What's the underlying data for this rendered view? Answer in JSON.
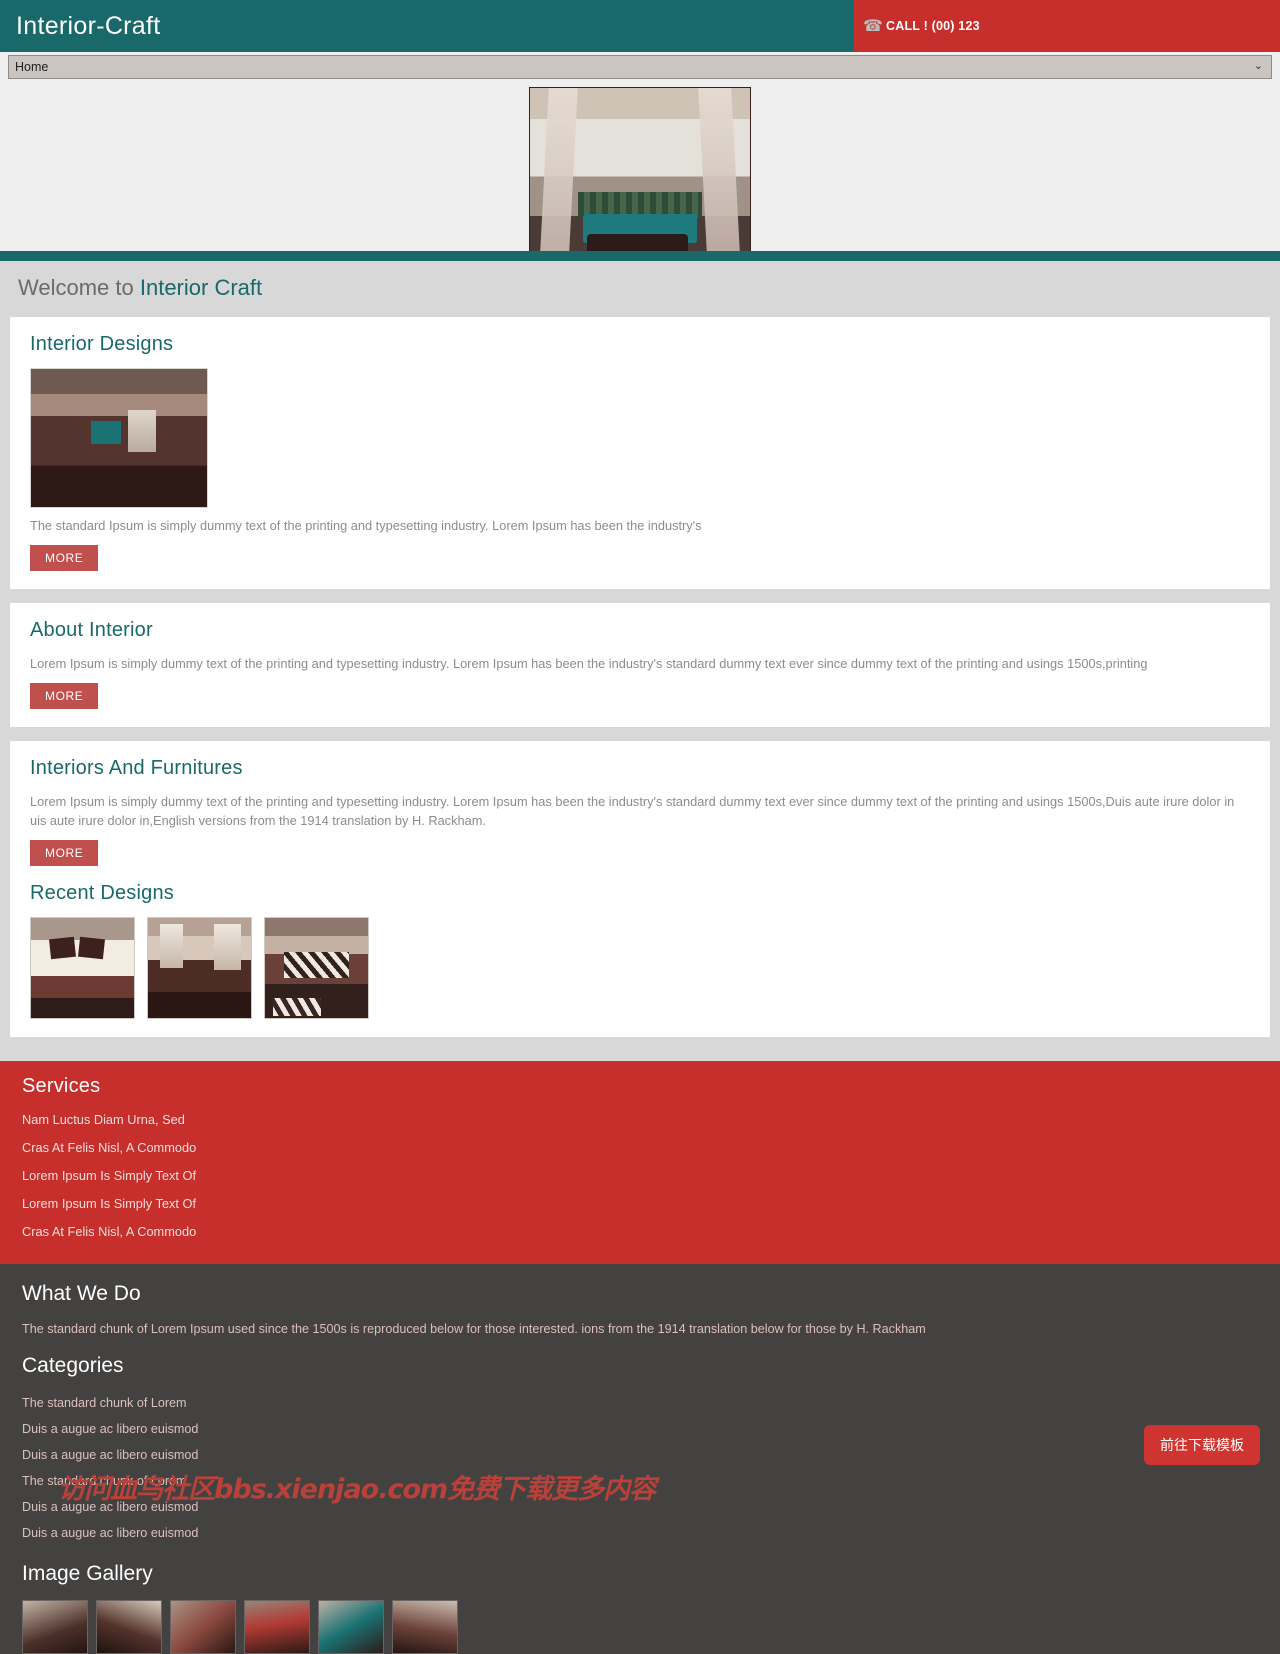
{
  "header": {
    "brand": "Interior-Craft",
    "phone_icon": "phone-icon",
    "call_text": "CALL ! (00) 123"
  },
  "nav": {
    "selected": "Home",
    "options": [
      "Home"
    ],
    "caret": "⌄"
  },
  "banner": {
    "alt": "outdoor-lounge-photo"
  },
  "main": {
    "welcome_prefix": "Welcome to ",
    "welcome_accent": "Interior Craft",
    "cards": [
      {
        "title": "Interior Designs",
        "body": "The standard Ipsum is simply dummy text of the printing and typesetting industry. Lorem Ipsum has been the industry's",
        "more_label": "MORE"
      },
      {
        "title": "About Interior",
        "body": "Lorem Ipsum is simply dummy text of the printing and typesetting industry. Lorem Ipsum has been the industry's standard dummy text ever since dummy text of the printing and usings 1500s,printing",
        "more_label": "MORE"
      },
      {
        "title": "Interiors And Furnitures",
        "body": "Lorem Ipsum is simply dummy text of the printing and typesetting industry. Lorem Ipsum has been the industry's standard dummy text ever since dummy text of the printing and usings 1500s,Duis aute irure dolor in uis aute irure dolor in,English versions from the 1914 translation by H. Rackham.",
        "more_label": "MORE"
      }
    ],
    "recent_title": "Recent Designs",
    "recent_images": [
      "bedroom-thumb",
      "desk-room-thumb",
      "striped-sofa-thumb"
    ]
  },
  "services": {
    "title": "Services",
    "items": [
      "Nam Luctus Diam Urna, Sed",
      "Cras At Felis Nisl, A Commodo",
      "Lorem Ipsum Is Simply Text Of",
      "Lorem Ipsum Is Simply Text Of",
      "Cras At Felis Nisl, A Commodo"
    ]
  },
  "footer": {
    "what_we_do_title": "What We Do",
    "what_we_do_text": "The standard chunk of Lorem Ipsum used since the 1500s is reproduced below for those interested. ions from the 1914 translation below for those by H. Rackham",
    "categories_title": "Categories",
    "categories": [
      "The standard chunk of Lorem",
      "Duis a augue ac libero euismod",
      "Duis a augue ac libero euismod",
      "The standard chunk of Lorem",
      "Duis a augue ac libero euismod",
      "Duis a augue ac libero euismod"
    ],
    "gallery_title": "Image Gallery",
    "gallery_count": 6
  },
  "overlay": {
    "watermark": "访问血鸟社区bbs.xienjao.com免费下载更多内容",
    "download_button": "前往下载模板"
  },
  "colors": {
    "teal": "#19696B",
    "red": "#C62F2B",
    "more_red": "#C0504D",
    "dark_footer": "#444240",
    "grey_bg": "#D8D8D8"
  }
}
